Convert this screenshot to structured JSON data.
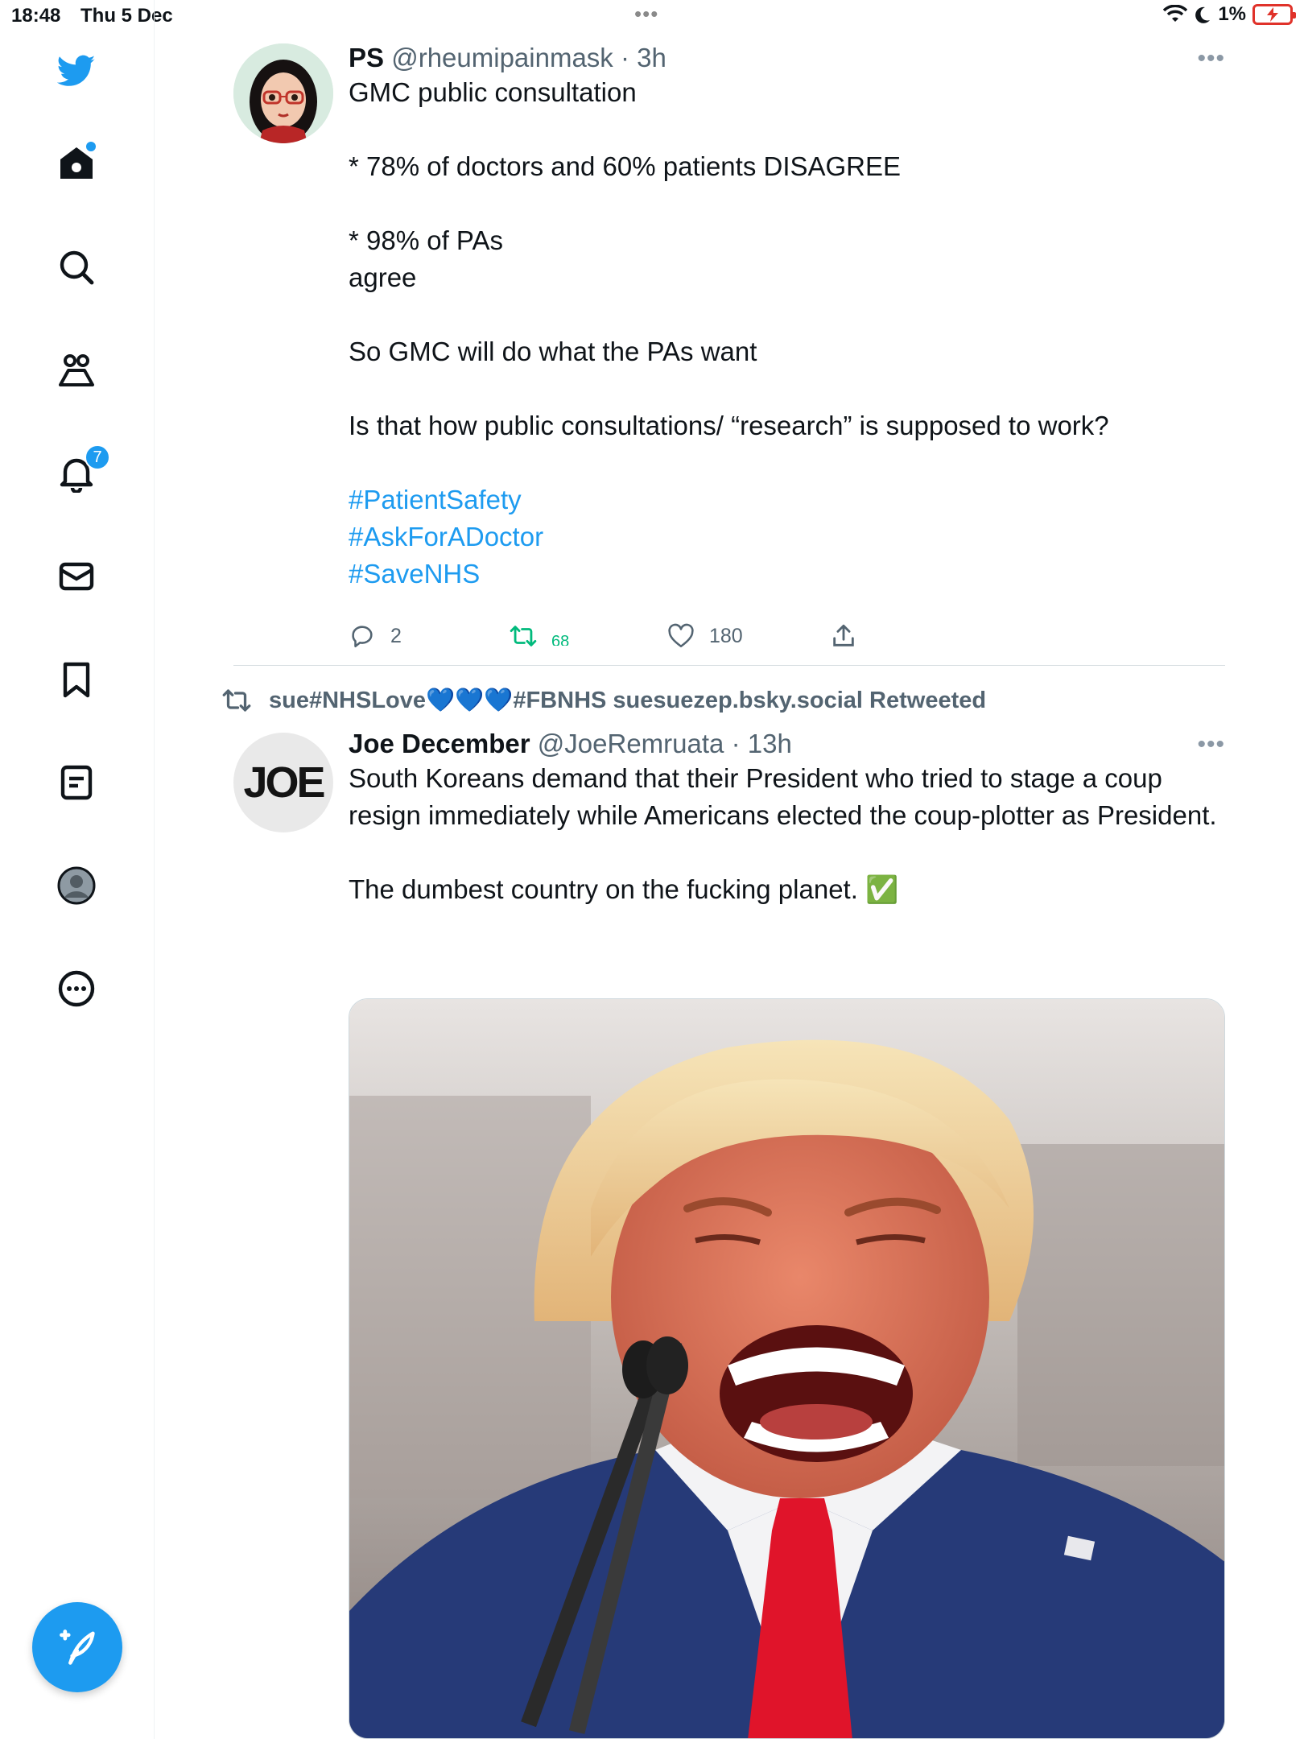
{
  "status_bar": {
    "time": "18:48",
    "date": "Thu 5 Dec",
    "battery": "1%"
  },
  "sidebar": {
    "notifications_badge": "7",
    "items": [
      {
        "icon": "twitter-logo-icon"
      },
      {
        "icon": "home-icon"
      },
      {
        "icon": "search-icon"
      },
      {
        "icon": "communities-icon"
      },
      {
        "icon": "notifications-icon"
      },
      {
        "icon": "messages-icon"
      },
      {
        "icon": "bookmarks-icon"
      },
      {
        "icon": "lists-icon"
      },
      {
        "icon": "profile-icon"
      },
      {
        "icon": "more-icon"
      }
    ],
    "compose_icon": "compose-tweet-icon"
  },
  "tweets": [
    {
      "name": "PS",
      "handle": "@rheumipainmask",
      "time": "· 3h",
      "text": "GMC public consultation\n\n* 78% of doctors and 60% patients DISAGREE\n\n* 98% of PAs\nagree\n\nSo GMC will do what the PAs want\n\nIs that how public consultations/ “research” is supposed to work?",
      "hashtags": [
        "#PatientSafety",
        "#AskForADoctor",
        "#SaveNHS"
      ],
      "replies": "2",
      "retweets": "68",
      "likes": "180"
    },
    {
      "retweeted_by": "sue#NHSLove💙💙💙#FBNHS suesuezep.bsky.social Retweeted",
      "name": "Joe December",
      "handle": "@JoeRemruata",
      "time": "· 13h",
      "avatar_text": "JOE",
      "text": "South Koreans demand that their President who tried to stage a coup resign immediately while Americans elected the coup-plotter as President.\n\nThe dumbest country on the fucking planet. ✅"
    }
  ],
  "colors": {
    "accent": "#1d9bf0",
    "retweet_green": "#00ba7c",
    "secondary_text": "#536471"
  }
}
